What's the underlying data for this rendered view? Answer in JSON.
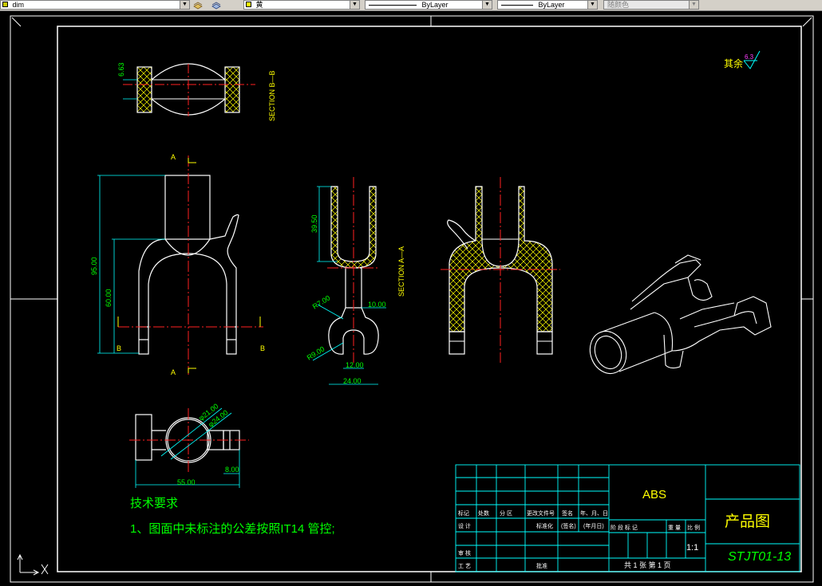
{
  "toolbar": {
    "layer_value": "dim",
    "color_value": "黄",
    "linetype_value": "ByLayer",
    "lineweight_value": "ByLayer",
    "plotstyle_value": "随颜色"
  },
  "drawing": {
    "roughness_label": "其余",
    "roughness_value": "6.3",
    "section_bb": "SECTION  B—B",
    "section_aa": "SECTION  A—A",
    "cut_labels": {
      "a": "A",
      "b": "B"
    },
    "dims": {
      "d_663": "6.63",
      "d_95": "95.00",
      "d_60": "60.00",
      "d_3950": "39.50",
      "d_10": "10.00",
      "d_r7": "R7.00",
      "d_r9": "R9.00",
      "d_12": "12.00",
      "d_24": "24.00",
      "d_phi21": "φ21.00",
      "d_phi24": "φ24.00",
      "d_55": "55.00",
      "d_8": "8.00"
    },
    "tech_title": "技术要求",
    "tech_item": "1、图面中未标注的公差按照IT14 管控;"
  },
  "title_block": {
    "material": "ABS",
    "drawing_name": "产品图",
    "drawing_no": "STJT01-13",
    "scale": "1:1",
    "headers": [
      "标记",
      "处数",
      "分 区",
      "更改文件号",
      "签名",
      "年、月、日"
    ],
    "row_design": [
      "设 计",
      "",
      "",
      "标准化",
      "(签名)",
      "(年月日)"
    ],
    "row_review": "审 核",
    "row_process": "工 艺",
    "approve": "批准",
    "stage_cols": [
      "阶 段 标 记",
      "重 量",
      "比 例"
    ],
    "sheet_text": "共 1 张   第 1 页"
  }
}
